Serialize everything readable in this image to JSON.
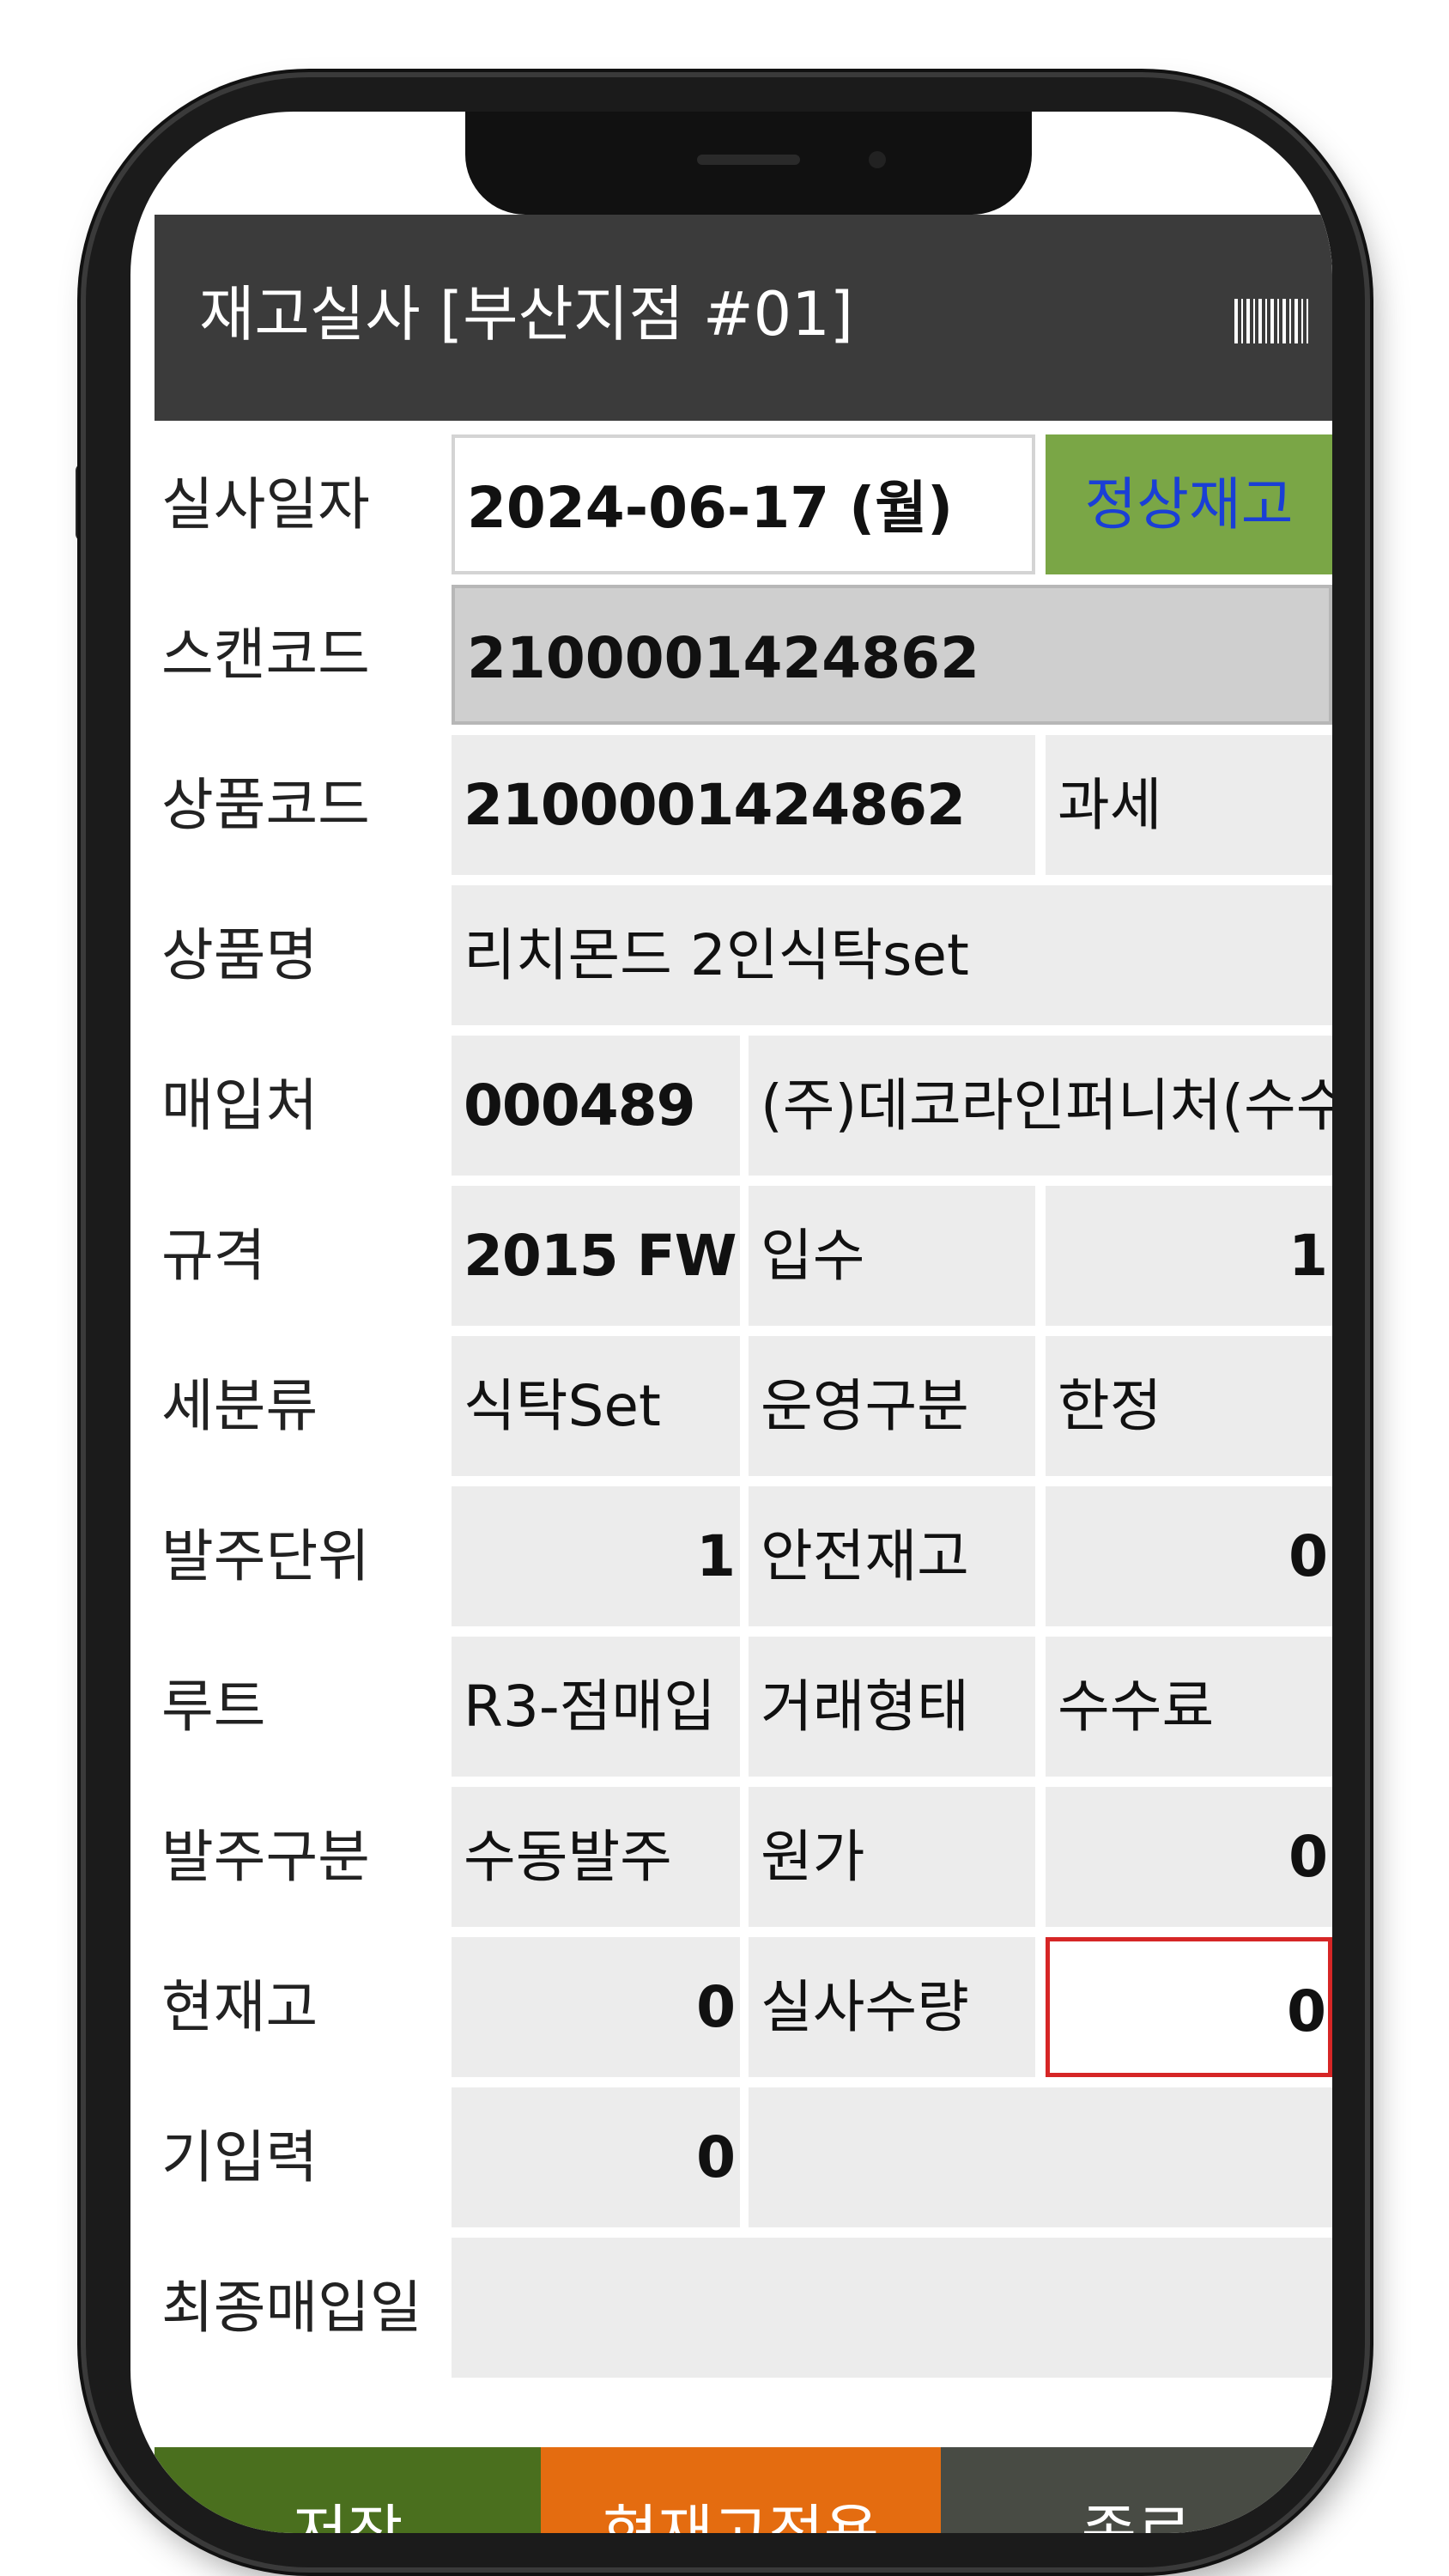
{
  "header": {
    "title": "재고실사 [부산지점 #01]",
    "barcode_icon": "barcode-icon"
  },
  "form": {
    "audit_date": {
      "label": "실사일자",
      "value": "2024-06-17 (월)",
      "status": "정상재고"
    },
    "scan_code": {
      "label": "스캔코드",
      "value": "2100001424862"
    },
    "product_code": {
      "label": "상품코드",
      "value": "2100001424862",
      "tax": "과세"
    },
    "product_name": {
      "label": "상품명",
      "value": "리치몬드 2인식탁set"
    },
    "supplier": {
      "label": "매입처",
      "code": "000489",
      "name": "(주)데코라인퍼니처(수수"
    },
    "spec": {
      "label": "규격",
      "value": "2015 FW",
      "label2": "입수",
      "value2": "1"
    },
    "subcategory": {
      "label": "세분류",
      "value": "식탁Set",
      "label2": "운영구분",
      "value2": "한정"
    },
    "order_unit": {
      "label": "발주단위",
      "value": "1",
      "label2": "안전재고",
      "value2": "0"
    },
    "route": {
      "label": "루트",
      "value": "R3-점매입",
      "label2": "거래형태",
      "value2": "수수료"
    },
    "order_type": {
      "label": "발주구분",
      "value": "수동발주",
      "label2": "원가",
      "value2": "0"
    },
    "current_stock": {
      "label": "현재고",
      "value": "0",
      "label2": "실사수량",
      "value2": "0"
    },
    "pre_entered": {
      "label": "기입력",
      "value": "0"
    },
    "last_purchase": {
      "label": "최종매입일",
      "value": ""
    }
  },
  "buttons": {
    "save": "저장",
    "apply_current": "현재고적용",
    "close": "종료"
  },
  "colors": {
    "titlebar": "#3b3b3b",
    "status_badge": "#7aa646",
    "status_text": "#1a3fd6",
    "save": "#4a6f1e",
    "apply": "#e46c10",
    "close": "#484b44",
    "qty_border": "#d62626"
  }
}
